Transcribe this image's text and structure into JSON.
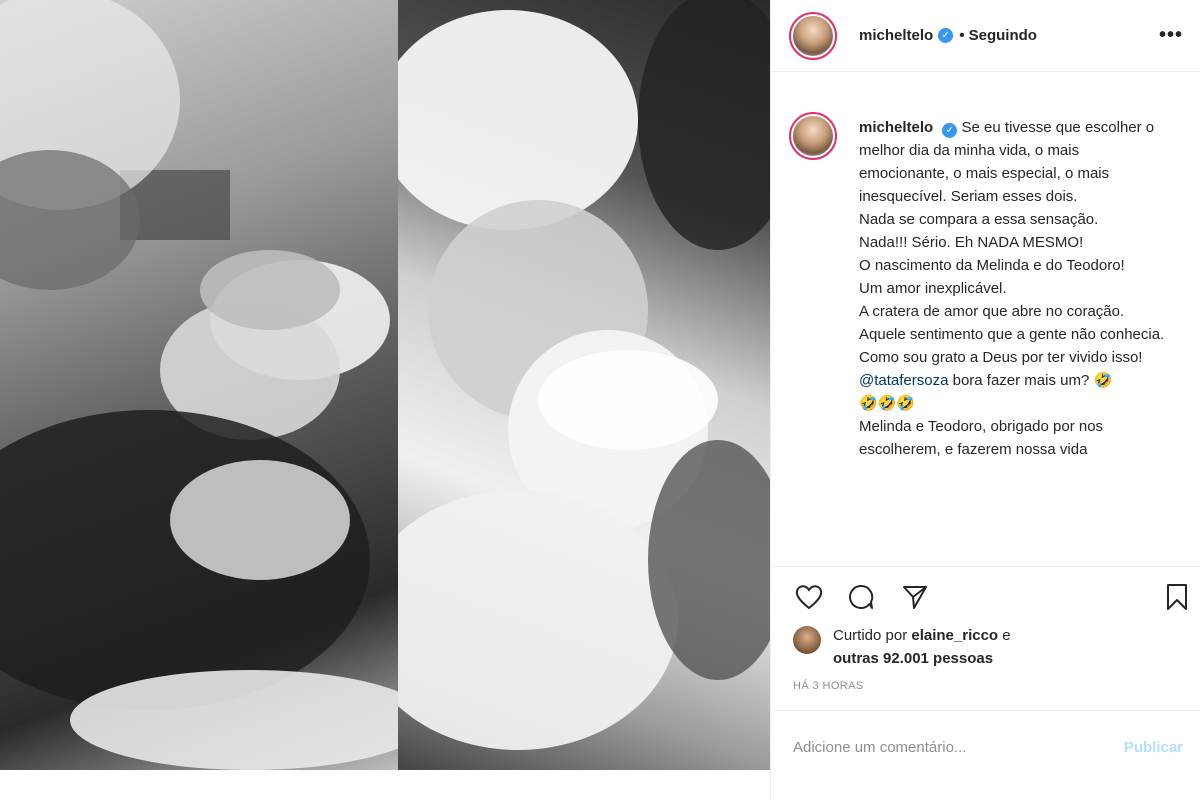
{
  "post": {
    "username": "micheltelo",
    "follow_status": "• Seguindo",
    "more_label": "•••",
    "verified_icon": "verified-badge-icon",
    "accent_color": "#3897f0"
  },
  "caption": {
    "username": "micheltelo",
    "lines": [
      "Se eu tivesse que escolher o melhor dia da minha vida, o mais emocionante, o mais especial, o mais inesquecível. Seriam esses dois.",
      "Nada se compara a essa sensação.",
      "Nada!!! Sério. Eh NADA MESMO!",
      "O nascimento da Melinda e do Teodoro!",
      "Um amor inexplicável.",
      "A cratera de amor que abre no coração. Aquele sentimento que a gente não conhecia.",
      "Como sou grato a Deus por ter vivido isso!"
    ],
    "mention": "@tatafersoza",
    "mention_text": " bora fazer mais um? 🤣",
    "emoji_line": "🤣🤣🤣",
    "last_line": "Melinda e Teodoro, obrigado por nos escolherem, e fazerem nossa vida"
  },
  "likes": {
    "prefix": "Curtido por ",
    "user": "elaine_ricco",
    "middle": " e",
    "others": "outras 92.001 pessoas"
  },
  "time": "HÁ 3 HORAS",
  "comment_box": {
    "placeholder": "Adicione um comentário...",
    "publish_label": "Publicar"
  }
}
